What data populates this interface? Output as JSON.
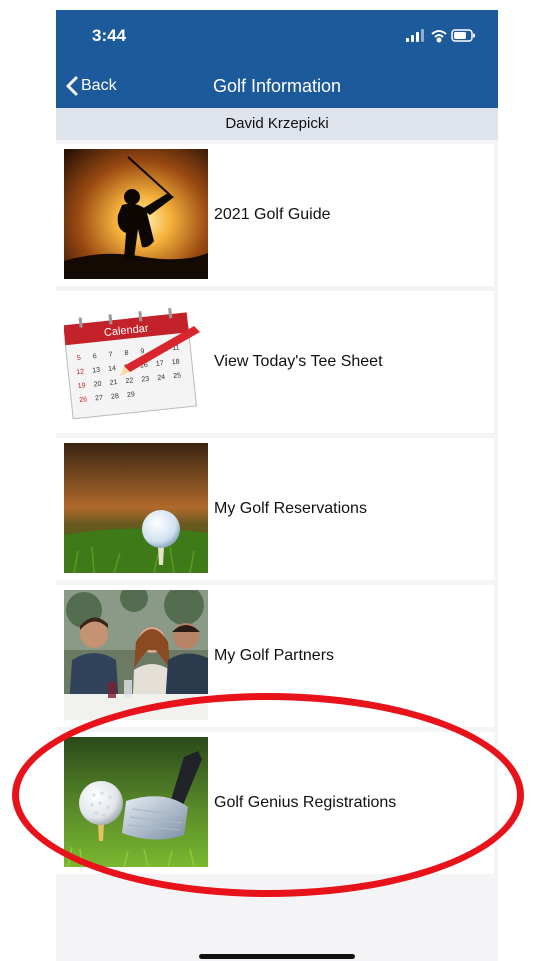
{
  "status_bar": {
    "time": "3:44",
    "icons": [
      "signal-icon",
      "wifi-icon",
      "battery-icon"
    ]
  },
  "nav": {
    "back_label": "Back",
    "title": "Golf Information"
  },
  "user": {
    "name": "David Krzepicki"
  },
  "menu": {
    "items": [
      {
        "label": "2021 Golf Guide",
        "image": "golfer-silhouette-image"
      },
      {
        "label": "View Today's Tee Sheet",
        "image": "calendar-image",
        "calendar_label": "Calendar"
      },
      {
        "label": "My Golf Reservations",
        "image": "golf-ball-on-tee-image"
      },
      {
        "label": "My Golf Partners",
        "image": "people-dining-image"
      },
      {
        "label": "Golf Genius Registrations",
        "image": "golf-ball-and-club-image"
      }
    ]
  },
  "colors": {
    "nav_blue": "#1c5a9c",
    "user_bar": "#dfe4ec",
    "annotation_red": "#e8121b"
  }
}
